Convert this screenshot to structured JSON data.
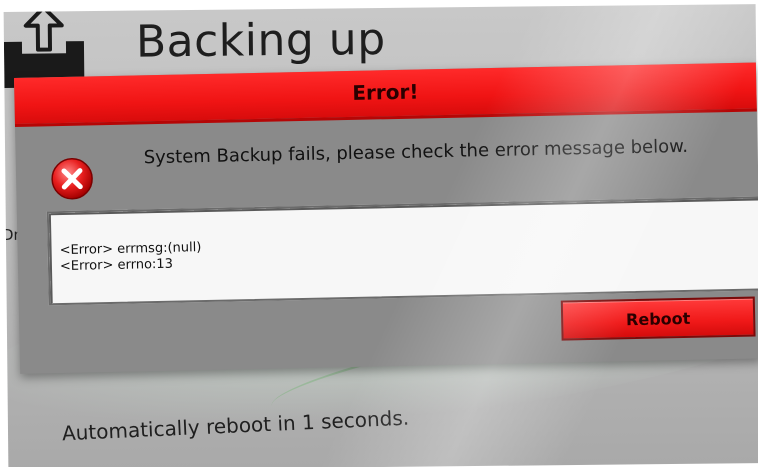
{
  "page": {
    "title": "Backing up",
    "cut_label": "Dne",
    "footer": "Automatically reboot in 1 seconds."
  },
  "dialog": {
    "title": "Error!",
    "message": "System Backup fails, please check the error message below.",
    "log_lines": [
      "<Error> errmsg:(null)",
      "<Error> errno:13"
    ],
    "reboot_label": "Reboot"
  },
  "icons": {
    "header": "backup-tray-icon",
    "dialog": "error-icon"
  },
  "colors": {
    "title_bar": "#f01414",
    "button": "#f01919",
    "dialog_body": "#8a8a8a",
    "screen_bg": "#c8c8c8",
    "log_bg": "#f7f7f7"
  }
}
